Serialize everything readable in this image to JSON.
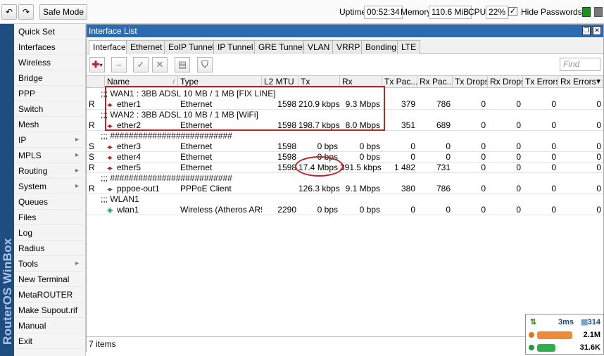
{
  "toolbar": {
    "safe_mode": "Safe Mode",
    "uptime_label": "Uptime:",
    "uptime_value": "00:52:34",
    "memory_label": "Memory:",
    "memory_value": "110.6 MiB",
    "cpu_label": "CPU:",
    "cpu_value": "22%",
    "hide_passwords_label": "Hide Passwords",
    "hide_passwords_checked": true
  },
  "brand": "RouterOS WinBox",
  "sidebar": {
    "items": [
      {
        "label": "Quick Set",
        "submenu": false
      },
      {
        "label": "Interfaces",
        "submenu": false
      },
      {
        "label": "Wireless",
        "submenu": false
      },
      {
        "label": "Bridge",
        "submenu": false
      },
      {
        "label": "PPP",
        "submenu": false
      },
      {
        "label": "Switch",
        "submenu": false
      },
      {
        "label": "Mesh",
        "submenu": false
      },
      {
        "label": "IP",
        "submenu": true
      },
      {
        "label": "MPLS",
        "submenu": true
      },
      {
        "label": "Routing",
        "submenu": true
      },
      {
        "label": "System",
        "submenu": true
      },
      {
        "label": "Queues",
        "submenu": false
      },
      {
        "label": "Files",
        "submenu": false
      },
      {
        "label": "Log",
        "submenu": false
      },
      {
        "label": "Radius",
        "submenu": false
      },
      {
        "label": "Tools",
        "submenu": true
      },
      {
        "label": "New Terminal",
        "submenu": false
      },
      {
        "label": "MetaROUTER",
        "submenu": false
      },
      {
        "label": "Make Supout.rif",
        "submenu": false
      },
      {
        "label": "Manual",
        "submenu": false
      },
      {
        "label": "Exit",
        "submenu": false
      }
    ]
  },
  "window": {
    "title": "Interface List",
    "tabs": [
      "Interface",
      "Ethernet",
      "EoIP Tunnel",
      "IP Tunnel",
      "GRE Tunnel",
      "VLAN",
      "VRRP",
      "Bonding",
      "LTE"
    ],
    "active_tab": "Interface",
    "find_placeholder": "Find",
    "columns": [
      "",
      "Name",
      "Type",
      "L2 MTU",
      "Tx",
      "Rx",
      "Tx Pac...",
      "Rx Pac...",
      "Tx Drops",
      "Rx Drops",
      "Tx Errors",
      "Rx Errors"
    ],
    "status": "7 items"
  },
  "rows": [
    {
      "kind": "comment",
      "text": ";;; WAN1 : 3BB ADSL 10 MB / 1 MB [FIX LINE]"
    },
    {
      "kind": "iface",
      "flag": "R",
      "icon": "eth",
      "name": "ether1",
      "type": "Ethernet",
      "l2mtu": "1598",
      "tx": "210.9 kbps",
      "rx": "9.3 Mbps",
      "txp": "379",
      "rxp": "786",
      "txd": "0",
      "rxd": "0",
      "txe": "0",
      "rxe": "0"
    },
    {
      "kind": "comment",
      "text": ";;; WAN2 : 3BB ADSL 10 MB / 1 MB [WiFi]"
    },
    {
      "kind": "iface",
      "flag": "R",
      "icon": "eth",
      "name": "ether2",
      "type": "Ethernet",
      "l2mtu": "1598",
      "tx": "198.7 kbps",
      "rx": "8.0 Mbps",
      "txp": "351",
      "rxp": "689",
      "txd": "0",
      "rxd": "0",
      "txe": "0",
      "rxe": "0"
    },
    {
      "kind": "comment",
      "text": ";;; ##########################"
    },
    {
      "kind": "iface",
      "flag": "S",
      "icon": "eth",
      "name": "ether3",
      "type": "Ethernet",
      "l2mtu": "1598",
      "tx": "0 bps",
      "rx": "0 bps",
      "txp": "0",
      "rxp": "0",
      "txd": "0",
      "rxd": "0",
      "txe": "0",
      "rxe": "0"
    },
    {
      "kind": "iface",
      "flag": "S",
      "icon": "eth",
      "name": "ether4",
      "type": "Ethernet",
      "l2mtu": "1598",
      "tx": "0 bps",
      "rx": "0 bps",
      "txp": "0",
      "rxp": "0",
      "txd": "0",
      "rxd": "0",
      "txe": "0",
      "rxe": "0"
    },
    {
      "kind": "iface",
      "flag": "R",
      "icon": "eth",
      "name": "ether5",
      "type": "Ethernet",
      "l2mtu": "1598",
      "tx": "17.4 Mbps",
      "rx": "391.5 kbps",
      "txp": "1 482",
      "rxp": "731",
      "txd": "0",
      "rxd": "0",
      "txe": "0",
      "rxe": "0"
    },
    {
      "kind": "comment",
      "text": ";;; ##########################"
    },
    {
      "kind": "iface",
      "flag": "R",
      "icon": "ppp",
      "name": "pppoe-out1",
      "type": "PPPoE Client",
      "l2mtu": "",
      "tx": "126.3 kbps",
      "rx": "9.1 Mbps",
      "txp": "380",
      "rxp": "786",
      "txd": "0",
      "rxd": "0",
      "txe": "0",
      "rxe": "0"
    },
    {
      "kind": "comment",
      "text": ";;; WLAN1"
    },
    {
      "kind": "iface",
      "flag": "",
      "icon": "wlan",
      "name": "wlan1",
      "type": "Wireless (Atheros AR9...",
      "l2mtu": "2290",
      "tx": "0 bps",
      "rx": "0 bps",
      "txp": "0",
      "rxp": "0",
      "txd": "0",
      "rxd": "0",
      "txe": "0",
      "rxe": "0"
    }
  ],
  "widget": {
    "ping": "3ms",
    "connections": "314",
    "upload": "2.1M",
    "download": "31.6K",
    "upload_color": "#ef8a3a",
    "download_color": "#2fae4b"
  },
  "colors": {
    "title_bar": "#2c6bb0",
    "brand_bar": "#1f4d7f",
    "annotation": "#b1282d"
  }
}
